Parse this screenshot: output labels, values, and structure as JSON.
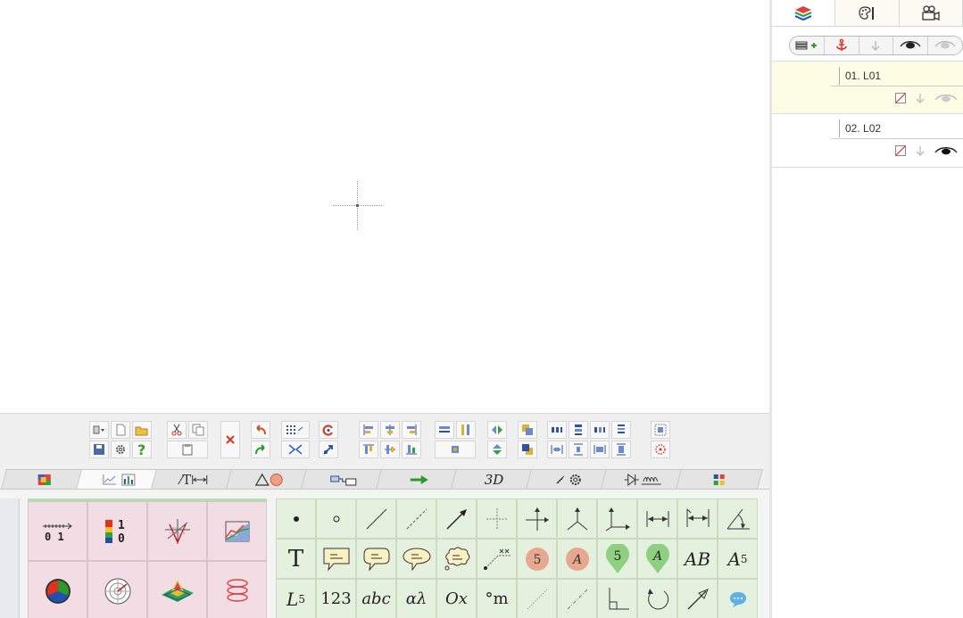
{
  "right_panel": {
    "tabs": [
      {
        "icon": "layers-icon"
      },
      {
        "icon": "palette-icon"
      },
      {
        "icon": "camera-icon"
      }
    ],
    "toolbar": [
      {
        "icon": "add-layer-icon"
      },
      {
        "icon": "anchor-icon"
      },
      {
        "icon": "move-down-icon"
      },
      {
        "icon": "show-all-icon"
      },
      {
        "icon": "hide-all-icon"
      }
    ],
    "layers": [
      {
        "name": "01. L01",
        "active": true
      },
      {
        "name": "02. L02",
        "active": false
      }
    ]
  },
  "category_tabs": [
    {
      "icon": "color-block-icon"
    },
    {
      "icon": "chart-icon"
    },
    {
      "text": "⁄T",
      "icon": "line-text-dimension-icon"
    },
    {
      "text": "△●",
      "icon": "shapes-icon"
    },
    {
      "icon": "connector-icon"
    },
    {
      "icon": "arrow-icon"
    },
    {
      "text": "3D",
      "icon": "3d-icon"
    },
    {
      "icon": "settings-icon"
    },
    {
      "icon": "circuit-icon"
    },
    {
      "icon": "grid-icon"
    }
  ],
  "chart_tools": [
    {
      "label_top": "0 1",
      "icon": "number-line-icon"
    },
    {
      "label_top": "1",
      "label_bottom": "0",
      "icon": "color-scale-icon"
    },
    {
      "icon": "3d-axis-icon"
    },
    {
      "icon": "area-chart-icon"
    },
    {
      "icon": "pie-chart-icon"
    },
    {
      "icon": "polar-chart-icon"
    },
    {
      "icon": "surface-plot-icon"
    },
    {
      "icon": "spiral-curve-icon"
    }
  ],
  "drawing_tools": {
    "row1": [
      "point",
      "circle-point",
      "line",
      "dashed-line",
      "arrow",
      "crosshair",
      "axis-2d",
      "axis-3d",
      "axis-corner",
      "dimension",
      "dimension-ext",
      "angle"
    ],
    "row2_labels": {
      "text": "T",
      "badge_number": "5",
      "badge_letter": "A",
      "pin_number": "5",
      "pin_letter": "A",
      "ab": "AB",
      "a5_main": "A",
      "a5_sub": "5"
    },
    "row3_labels": {
      "l5_main": "L",
      "l5_sub": "5",
      "num": "123",
      "abc": "abc",
      "greek": "αλ",
      "ox": "Ox",
      "degree": "°m"
    }
  }
}
